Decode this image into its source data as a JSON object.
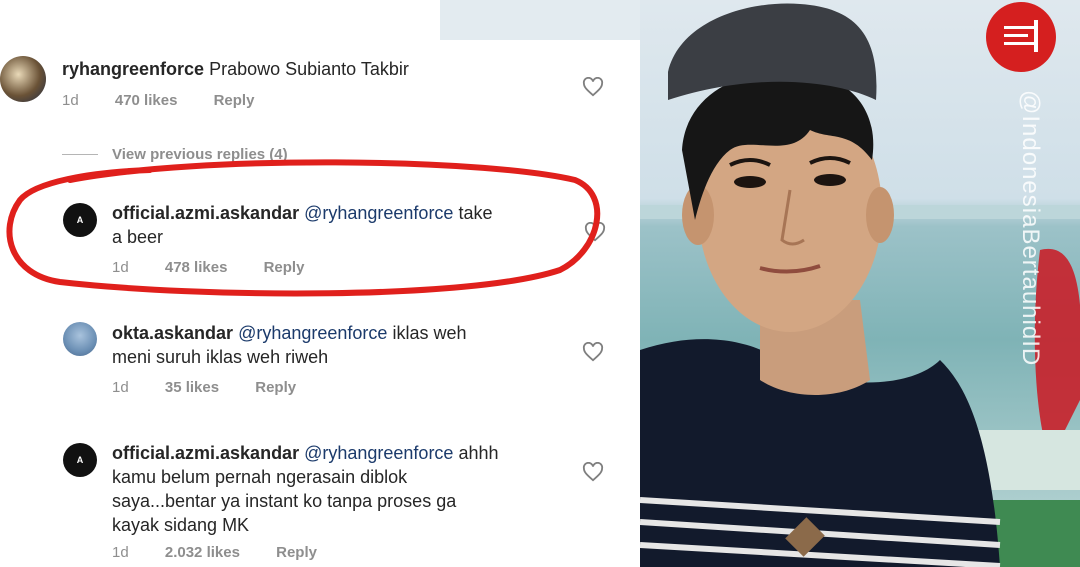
{
  "comments": [
    {
      "username": "ryhangreenforce",
      "mention": "",
      "text": "Prabowo Subianto Takbir",
      "time": "1d",
      "likes": "470 likes",
      "reply": "Reply"
    },
    {
      "username": "official.azmi.askandar",
      "mention": "@ryhangreenforce",
      "text_line1": "take",
      "text_line2": "a beer",
      "time": "1d",
      "likes": "478 likes",
      "reply": "Reply"
    },
    {
      "username": "okta.askandar",
      "mention": "@ryhangreenforce",
      "text_line1": "iklas weh",
      "text_line2": "meni suruh iklas weh riweh",
      "time": "1d",
      "likes": "35 likes",
      "reply": "Reply"
    },
    {
      "username": "official.azmi.askandar",
      "mention": "@ryhangreenforce",
      "text_line1": "ahhh",
      "text_line2": "kamu belum pernah ngerasain diblok",
      "text_line3": "saya...bentar ya instant ko tanpa proses ga",
      "text_line4": "kayak sidang MK",
      "time": "1d",
      "likes": "2.032 likes",
      "reply": "Reply"
    }
  ],
  "view_previous": "View previous replies (4)",
  "avatar_letter": "A",
  "watermark": "@IndonesiaBertauhidID",
  "colors": {
    "highlight_ring": "#e0201c",
    "muted_text": "#8e8e8e",
    "mention": "#1b3a6b",
    "logo_bg": "#d51f1f"
  },
  "icons": [
    "heart-icon",
    "avatar",
    "red-circle-highlight",
    "brand-logo"
  ]
}
